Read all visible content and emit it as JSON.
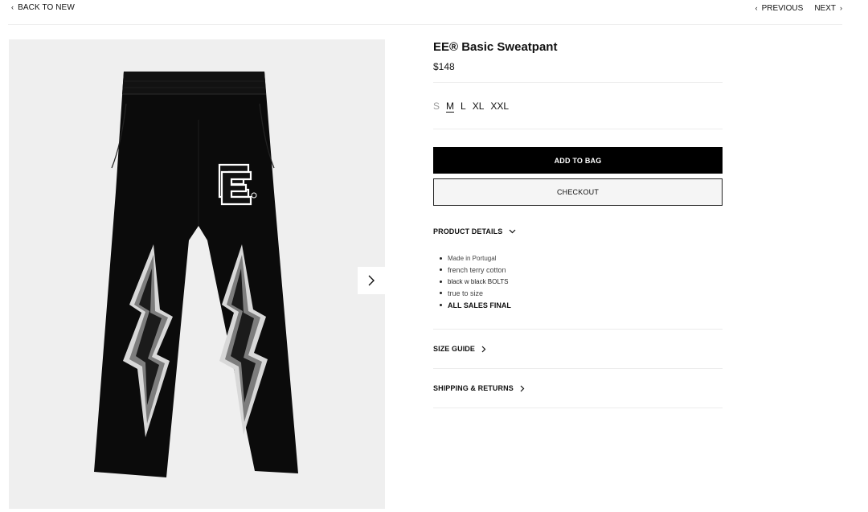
{
  "nav": {
    "back_label": "BACK TO NEW",
    "previous_label": "PREVIOUS",
    "next_label": "NEXT"
  },
  "product": {
    "title": "EE® Basic Sweatpant",
    "price": "$148",
    "sizes": [
      {
        "label": "S",
        "state": "unavailable"
      },
      {
        "label": "M",
        "state": "selected"
      },
      {
        "label": "L",
        "state": "available"
      },
      {
        "label": "XL",
        "state": "available"
      },
      {
        "label": "XXL",
        "state": "available"
      }
    ]
  },
  "actions": {
    "add_to_bag_label": "ADD TO BAG",
    "checkout_label": "CHECKOUT"
  },
  "sections": {
    "product_details_label": "PRODUCT DETAILS",
    "details": [
      "Made in Portugal",
      "french terry cotton",
      "black w black BOLTS",
      "true to size",
      "ALL SALES FINAL"
    ],
    "size_guide_label": "SIZE GUIDE",
    "shipping_label": "SHIPPING & RETURNS"
  },
  "icons": {
    "back": "chevron-left-icon",
    "previous": "chevron-left-icon",
    "next": "chevron-right-icon",
    "gallery_next": "chevron-right-icon",
    "details_toggle": "chevron-down-icon",
    "size_guide": "chevron-right-icon",
    "shipping": "chevron-right-icon"
  },
  "colors": {
    "primary_button": "#000000",
    "gallery_background": "#efefef",
    "unavailable_size": "#9a9a9a"
  }
}
